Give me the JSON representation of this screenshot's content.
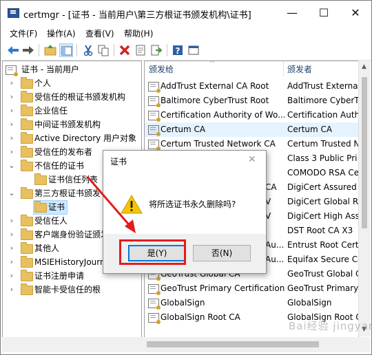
{
  "window": {
    "title": "certmgr - [证书 - 当前用户\\第三方根证书颁发机构\\证书]",
    "controls": [
      "—",
      "☐",
      "✕"
    ]
  },
  "menu": [
    "文件(F)",
    "操作(A)",
    "查看(V)",
    "帮助(H)"
  ],
  "toolbar": {
    "icons": [
      "back-arrow-icon",
      "forward-arrow-icon",
      "up-folder-icon",
      "show-hide-tree-icon",
      "cut-icon",
      "copy-icon",
      "delete-icon",
      "properties-icon",
      "export-icon",
      "help-icon",
      "console-icon"
    ]
  },
  "tree": {
    "root": "证书 - 当前用户",
    "items": [
      {
        "label": "个人",
        "expanded": false
      },
      {
        "label": "受信任的根证书颁发机构",
        "expanded": false
      },
      {
        "label": "企业信任",
        "expanded": false
      },
      {
        "label": "中间证书颁发机构",
        "expanded": false
      },
      {
        "label": "Active Directory 用户对象",
        "expanded": false
      },
      {
        "label": "受信任的发布者",
        "expanded": false
      },
      {
        "label": "不信任的证书",
        "expanded": true
      },
      {
        "label": "证书信任列表",
        "child": true
      },
      {
        "label": "第三方根证书颁发",
        "expanded": true
      },
      {
        "label": "证书",
        "child": true,
        "selected": true
      },
      {
        "label": "受信任人",
        "expanded": false
      },
      {
        "label": "客户端身份验证颁发",
        "expanded": false
      },
      {
        "label": "其他人",
        "expanded": false
      },
      {
        "label": "MSIEHistoryJourn",
        "expanded": false
      },
      {
        "label": "证书注册申请",
        "expanded": false
      },
      {
        "label": "智能卡受信任的根",
        "expanded": false
      }
    ]
  },
  "list": {
    "columns": [
      "颁发给",
      "颁发者"
    ],
    "rows": [
      {
        "issued_to": "AddTrust External CA Root",
        "issued_by": "AddTrust External"
      },
      {
        "issued_to": "Baltimore CyberTrust Root",
        "issued_by": "Baltimore CyberT"
      },
      {
        "issued_to": "Certification Authority of Wo...",
        "issued_by": "Certification Auth"
      },
      {
        "issued_to": "Certum CA",
        "issued_by": "Certum CA",
        "selected": true
      },
      {
        "issued_to": "Certum Trusted Network CA",
        "issued_by": "Certum Trusted N"
      },
      {
        "issued_to": "",
        "issued_by": "Class 3 Public Pri"
      },
      {
        "issued_to": "",
        "issued_by": "COMODO RSA Ce"
      },
      {
        "issued_to": "CA",
        "issued_by": "DigiCert Assured"
      },
      {
        "issued_to": "V",
        "issued_by": "DigiCert Global R"
      },
      {
        "issued_to": "V",
        "issued_by": "DigiCert High Ass"
      },
      {
        "issued_to": "",
        "issued_by": "DST Root CA X3"
      },
      {
        "issued_to": "Au...",
        "issued_by": "Entrust Root Certi"
      },
      {
        "issued_to": "Au...",
        "issued_by": "Equifax Secure Ce"
      },
      {
        "issued_to": "GeoTrust Global CA",
        "issued_by": "GeoTrust Global C"
      },
      {
        "issued_to": "GeoTrust Primary Certification...",
        "issued_by": "GeoTrust Primary"
      },
      {
        "issued_to": "GlobalSign",
        "issued_by": "GlobalSign"
      },
      {
        "issued_to": "GlobalSign Root CA",
        "issued_by": "GlobalSign Root C"
      }
    ]
  },
  "dialog": {
    "title": "证书",
    "message": "将所选证书永久删除吗?",
    "yes_label": "是(Y)",
    "no_label": "否(N)",
    "close": "✕"
  },
  "colors": {
    "highlight": "#e31b1b",
    "arrow": "#e31b1b",
    "selection": "#cce8ff"
  },
  "watermark": "Bai经验 jingyan"
}
